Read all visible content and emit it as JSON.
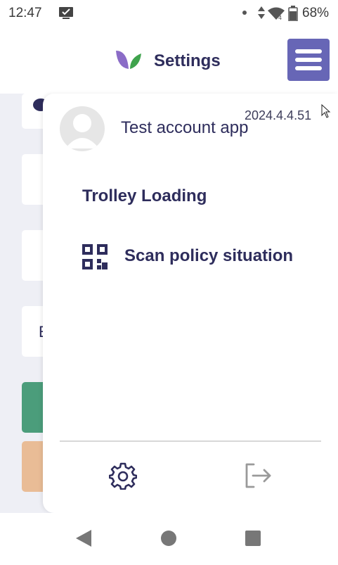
{
  "status_bar": {
    "time": "12:47",
    "battery_percent": "68%",
    "icons": [
      "notification-check-icon",
      "dot-icon",
      "data-arrows-icon",
      "wifi-icon",
      "battery-icon"
    ]
  },
  "header": {
    "title": "Settings",
    "logo_icon": "leaf-logo-icon",
    "menu_icon": "hamburger-menu-icon",
    "accent_color": "#6766b6"
  },
  "drawer": {
    "account_name": "Test account app",
    "version": "2024.4.4.51",
    "items": [
      {
        "label": "Trolley Loading"
      },
      {
        "label": "Scan policy situation",
        "icon": "qr-code-icon"
      }
    ],
    "footer": {
      "settings_icon": "gear-icon",
      "logout_icon": "logout-icon"
    }
  },
  "background": {
    "partial_letter": "E"
  },
  "nav_bar": {
    "icons": [
      "back-icon",
      "home-icon",
      "recents-icon"
    ]
  },
  "colors": {
    "text_primary": "#2e2d5c",
    "green_card": "#4b9d7b",
    "peach_card": "#e9bc96",
    "page_bg": "#eeeff5"
  }
}
